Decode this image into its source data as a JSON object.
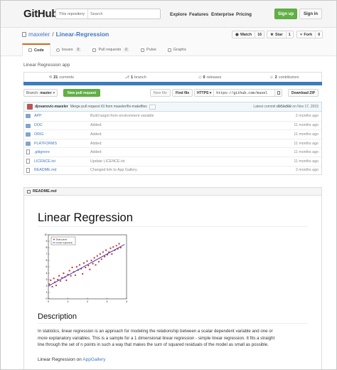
{
  "header": {
    "logo": "GitHub",
    "search_scope": "This repository",
    "search_placeholder": "Search",
    "nav": [
      "Explore",
      "Features",
      "Enterprise",
      "Pricing"
    ],
    "signup_label": "Sign up",
    "signin_label": "Sign in"
  },
  "repo": {
    "owner": "maxeler",
    "separator": "/",
    "name": "Linear-Regression",
    "watch_label": "Watch",
    "watch_count": "16",
    "star_label": "Star",
    "star_count": "1",
    "fork_label": "Fork",
    "fork_count": "6",
    "tabs": [
      {
        "label": "Code",
        "count": ""
      },
      {
        "label": "Issues",
        "count": "0"
      },
      {
        "label": "Pull requests",
        "count": "0"
      },
      {
        "label": "Pulse",
        "count": ""
      },
      {
        "label": "Graphs",
        "count": ""
      }
    ],
    "description": "Linear Regression app",
    "summary": [
      {
        "num": "21",
        "label": "commits"
      },
      {
        "num": "1",
        "label": "branch"
      },
      {
        "num": "0",
        "label": "releases"
      },
      {
        "num": "2",
        "label": "contributors"
      }
    ],
    "lang_color": "#3c7cbf"
  },
  "filenav": {
    "branch_prefix": "Branch:",
    "branch": "master",
    "new_pr": "New pull request",
    "new_file": "New file",
    "find_file": "Find file",
    "protocol": "HTTPS",
    "clone_url": "https://github.com/maxel",
    "download": "Download ZIP"
  },
  "commit": {
    "author": "djovanovic-maxeler",
    "message": "Merge pull request #3 from maxeler/fix-makefiles",
    "more": "...",
    "latest_prefix": "Latest commit",
    "sha": "d959d98",
    "date": "on Nov 17, 2015"
  },
  "files": [
    {
      "type": "dir",
      "name": "APP",
      "message": "Build target from environment variable",
      "age": "2 months ago"
    },
    {
      "type": "dir",
      "name": "DOC",
      "message": "Added:",
      "age": "11 months ago"
    },
    {
      "type": "dir",
      "name": "ORIG",
      "message": "Added:",
      "age": "11 months ago"
    },
    {
      "type": "dir",
      "name": "PLATFORMS",
      "message": "Added:",
      "age": "11 months ago"
    },
    {
      "type": "file",
      "name": ".gitignore",
      "message": "Added:",
      "age": "11 months ago"
    },
    {
      "type": "file",
      "name": "LICENCE.txt",
      "message": "Update LICENCE.txt",
      "age": "11 months ago"
    },
    {
      "type": "file",
      "name": "README.md",
      "message": "Changed link to App Gallery.",
      "age": "2 months ago"
    }
  ],
  "readme": {
    "filename": "README.md",
    "title": "Linear Regression",
    "section": "Description",
    "paragraph_lines": [
      "In statistics, linear regression is an approach for modeling the relationship between a scalar dependent variable and one or",
      "more explanatory variables. This is a sample for a 1 dimensional linear regression - simple linear regression. It fits a straight",
      "line through the set of n points in such a way that makes the sum of squared residuals of the model as small as possible."
    ],
    "link_prefix": "Linear Regression on",
    "link_text": "AppGallery"
  },
  "chart_data": {
    "type": "scatter",
    "title": "",
    "xlabel": "",
    "ylabel": "",
    "xlim": [
      0,
      4
    ],
    "ylim": [
      0,
      10
    ],
    "x_ticks": [
      "0",
      "1",
      "2",
      "3",
      "4"
    ],
    "y_ticks": [
      "0",
      "1",
      "2",
      "3",
      "4",
      "5",
      "6",
      "7",
      "8",
      "9",
      "10"
    ],
    "legend": "top-left",
    "grid": false,
    "series": [
      {
        "name": "Data points",
        "kind": "scatter",
        "color": "#d22",
        "x": [
          0.05,
          0.12,
          0.2,
          0.28,
          0.33,
          0.4,
          0.48,
          0.55,
          0.62,
          0.7,
          0.78,
          0.85,
          0.92,
          1.0,
          1.08,
          1.15,
          1.22,
          1.3,
          1.38,
          1.45,
          1.52,
          1.6,
          1.68,
          1.75,
          1.82,
          1.9,
          1.98,
          2.05,
          2.12,
          2.2,
          2.28,
          2.35,
          2.42,
          2.5,
          2.58,
          2.65,
          2.72,
          2.8,
          2.88,
          2.95,
          3.02,
          3.1,
          3.18,
          3.25,
          3.32,
          3.4,
          3.48,
          3.55,
          3.62,
          3.7
        ],
        "y": [
          2.3,
          2.9,
          1.9,
          3.2,
          2.6,
          2.1,
          3.0,
          3.6,
          2.8,
          3.3,
          4.0,
          3.4,
          2.9,
          3.8,
          4.4,
          3.6,
          4.9,
          4.2,
          3.7,
          5.0,
          4.5,
          5.3,
          4.7,
          3.9,
          5.6,
          4.9,
          5.9,
          5.2,
          4.6,
          6.0,
          5.5,
          6.4,
          5.3,
          6.7,
          5.8,
          7.0,
          6.2,
          7.3,
          6.6,
          7.6,
          6.9,
          7.3,
          7.9,
          7.0,
          8.1,
          7.6,
          8.3,
          7.8,
          8.6,
          8.0
        ]
      },
      {
        "name": "Linear regression",
        "kind": "line",
        "color": "#2233bb",
        "x": [
          0,
          3.9
        ],
        "y": [
          2.0,
          8.5
        ]
      }
    ]
  }
}
